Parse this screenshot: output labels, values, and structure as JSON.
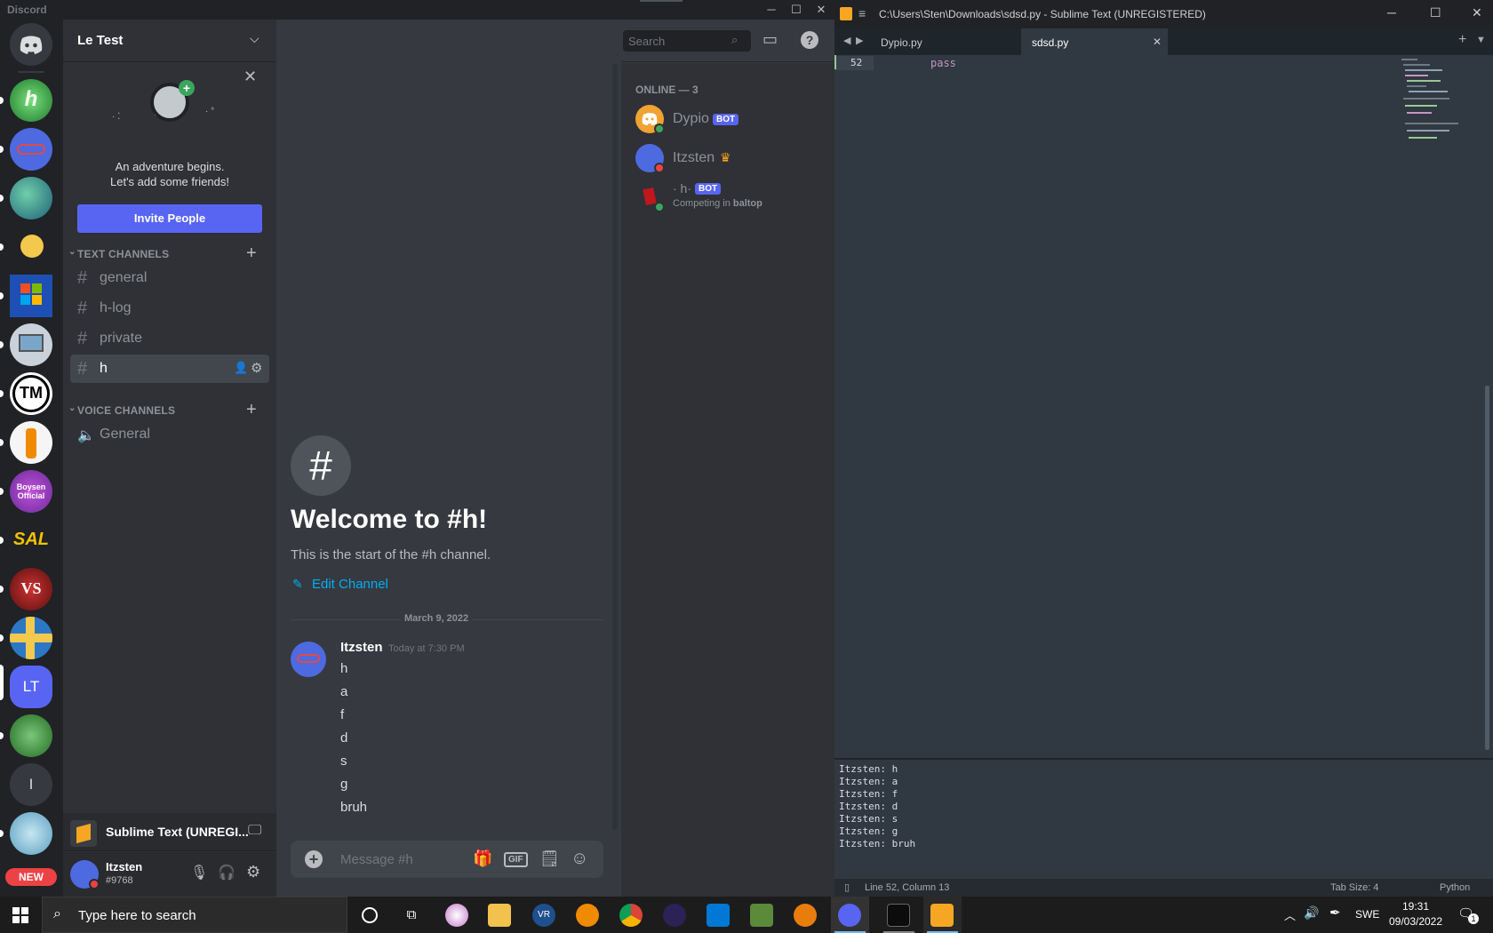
{
  "discord": {
    "brand": "Discord",
    "window_controls": {
      "minimize": "─",
      "maximize": "☐",
      "close": "✕"
    },
    "guilds": [
      {
        "label": "",
        "color": "#5865f2",
        "icon": "discord-logo-icon"
      },
      {
        "label": "h",
        "color": "#2fa84f"
      },
      {
        "label": "",
        "color": "#4e6ae0"
      },
      {
        "label": "",
        "color": "#3c8f6a"
      },
      {
        "label": "",
        "color": "#202225"
      },
      {
        "label": "",
        "color": "#2b6fd6"
      },
      {
        "label": "",
        "color": "#9aa7b4"
      },
      {
        "label": "TM",
        "color": "#ffffff"
      },
      {
        "label": "",
        "color": "#f5f5f5"
      },
      {
        "label": "Boysen Official",
        "color": "#9c3cbf"
      },
      {
        "label": "SAL",
        "color": "#202225"
      },
      {
        "label": "VS",
        "color": "#8a1f1f"
      },
      {
        "label": "",
        "color": "#2c78c5"
      },
      {
        "label": "LT",
        "color": "#5865f2"
      },
      {
        "label": "",
        "color": "#3a7d3a"
      },
      {
        "label": "I",
        "color": "#36393f"
      },
      {
        "label": "",
        "color": "#7cbbd6"
      }
    ],
    "new_badge": "NEW",
    "server": {
      "name": "Le Test"
    },
    "invite_card": {
      "line1": "An adventure begins.",
      "line2": "Let's add some friends!",
      "button": "Invite People"
    },
    "text_category": "TEXT CHANNELS",
    "text_channels": [
      "general",
      "h-log",
      "private",
      "h"
    ],
    "voice_category": "VOICE CHANNELS",
    "voice_channels": [
      "General"
    ],
    "activity": {
      "text": "Sublime Text (UNREGI..."
    },
    "user": {
      "name": "Itzsten",
      "tag": "#9768"
    },
    "channel_header": {
      "name": "h",
      "search_placeholder": "Search"
    },
    "welcome": {
      "title": "Welcome to #h!",
      "subtitle": "This is the start of the #h channel.",
      "edit": "Edit Channel"
    },
    "date_divider": "March 9, 2022",
    "message": {
      "author": "Itzsten",
      "timestamp": "Today at 7:30 PM",
      "lines": [
        "h",
        "a",
        "f",
        "d",
        "s",
        "g",
        "bruh"
      ]
    },
    "composer": {
      "placeholder": "Message #h",
      "gif": "GIF"
    },
    "members": {
      "header": "ONLINE — 3",
      "list": [
        {
          "name": "Dypio",
          "badge": "BOT",
          "activity": ""
        },
        {
          "name": "Itzsten",
          "badge": "",
          "activity": ""
        },
        {
          "name": "· h·",
          "badge": "BOT",
          "activity_prefix": "Competing in ",
          "activity_bold": "baltop"
        }
      ]
    },
    "colors": {
      "blurple": "#5865f2",
      "online": "#3ba55d",
      "dnd": "#ed4245"
    }
  },
  "sublime": {
    "title": "C:\\Users\\Sten\\Downloads\\sdsd.py - Sublime Text (UNREGISTERED)",
    "tabs": [
      {
        "label": "Dypio.py"
      },
      {
        "label": "sdsd.py"
      }
    ],
    "editor": {
      "line_number": "52",
      "code": "pass"
    },
    "console_lines": [
      "Itzsten: h",
      "Itzsten: a",
      "Itzsten: f",
      "Itzsten: d",
      "Itzsten: s",
      "Itzsten: g",
      "Itzsten: bruh"
    ],
    "status": {
      "position": "Line 52, Column 13",
      "tab_size": "Tab Size: 4",
      "syntax": "Python"
    }
  },
  "taskbar": {
    "search_placeholder": "Type here to search",
    "language": "SWE",
    "time": "19:31",
    "date": "09/03/2022",
    "notification_count": "1"
  }
}
